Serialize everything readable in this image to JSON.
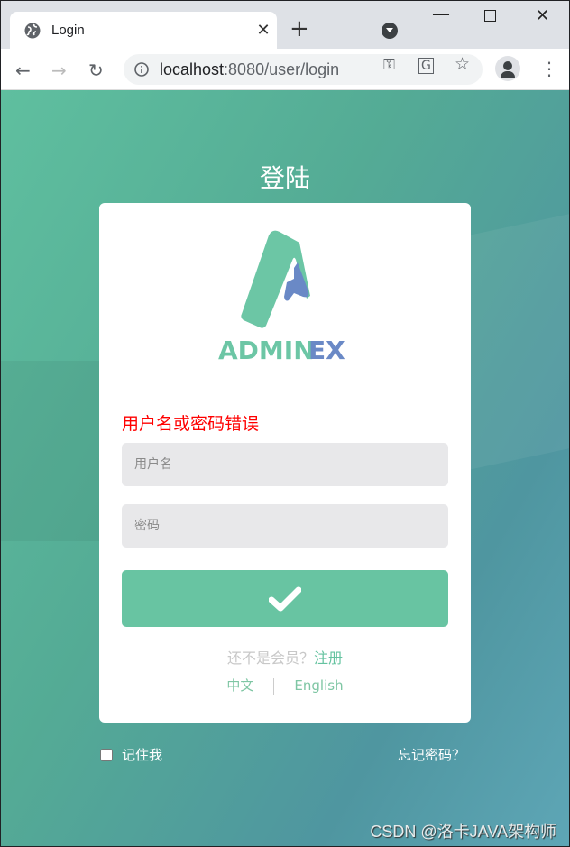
{
  "browser": {
    "tab_title": "Login",
    "url_host": "localhost",
    "url_rest": ":8080/user/login",
    "icons": [
      "globe-icon",
      "close-icon",
      "plus-icon",
      "tab-search-icon",
      "minimize-icon",
      "maximize-icon",
      "window-close-icon",
      "back-icon",
      "forward-icon",
      "reload-icon",
      "info-icon",
      "key-icon",
      "translate-icon",
      "star-icon",
      "profile-icon",
      "menu-icon"
    ]
  },
  "page": {
    "heading": "登陆",
    "logo": {
      "text_a": "ADMIN",
      "text_b": "EX",
      "green": "#6cc6a5",
      "blue": "#6a89c6"
    },
    "error": "用户名或密码错误",
    "username_placeholder": "用户名",
    "password_placeholder": "密码",
    "register_prompt": "还不是会员？",
    "register_link": "注册",
    "lang_zh": "中文",
    "lang_en": "English",
    "remember": "记住我",
    "forgot": "忘记密码？",
    "watermark": "CSDN @洛卡JAVA架构师",
    "colors": {
      "accent": "#68c4a2",
      "error": "#ff0000"
    }
  }
}
